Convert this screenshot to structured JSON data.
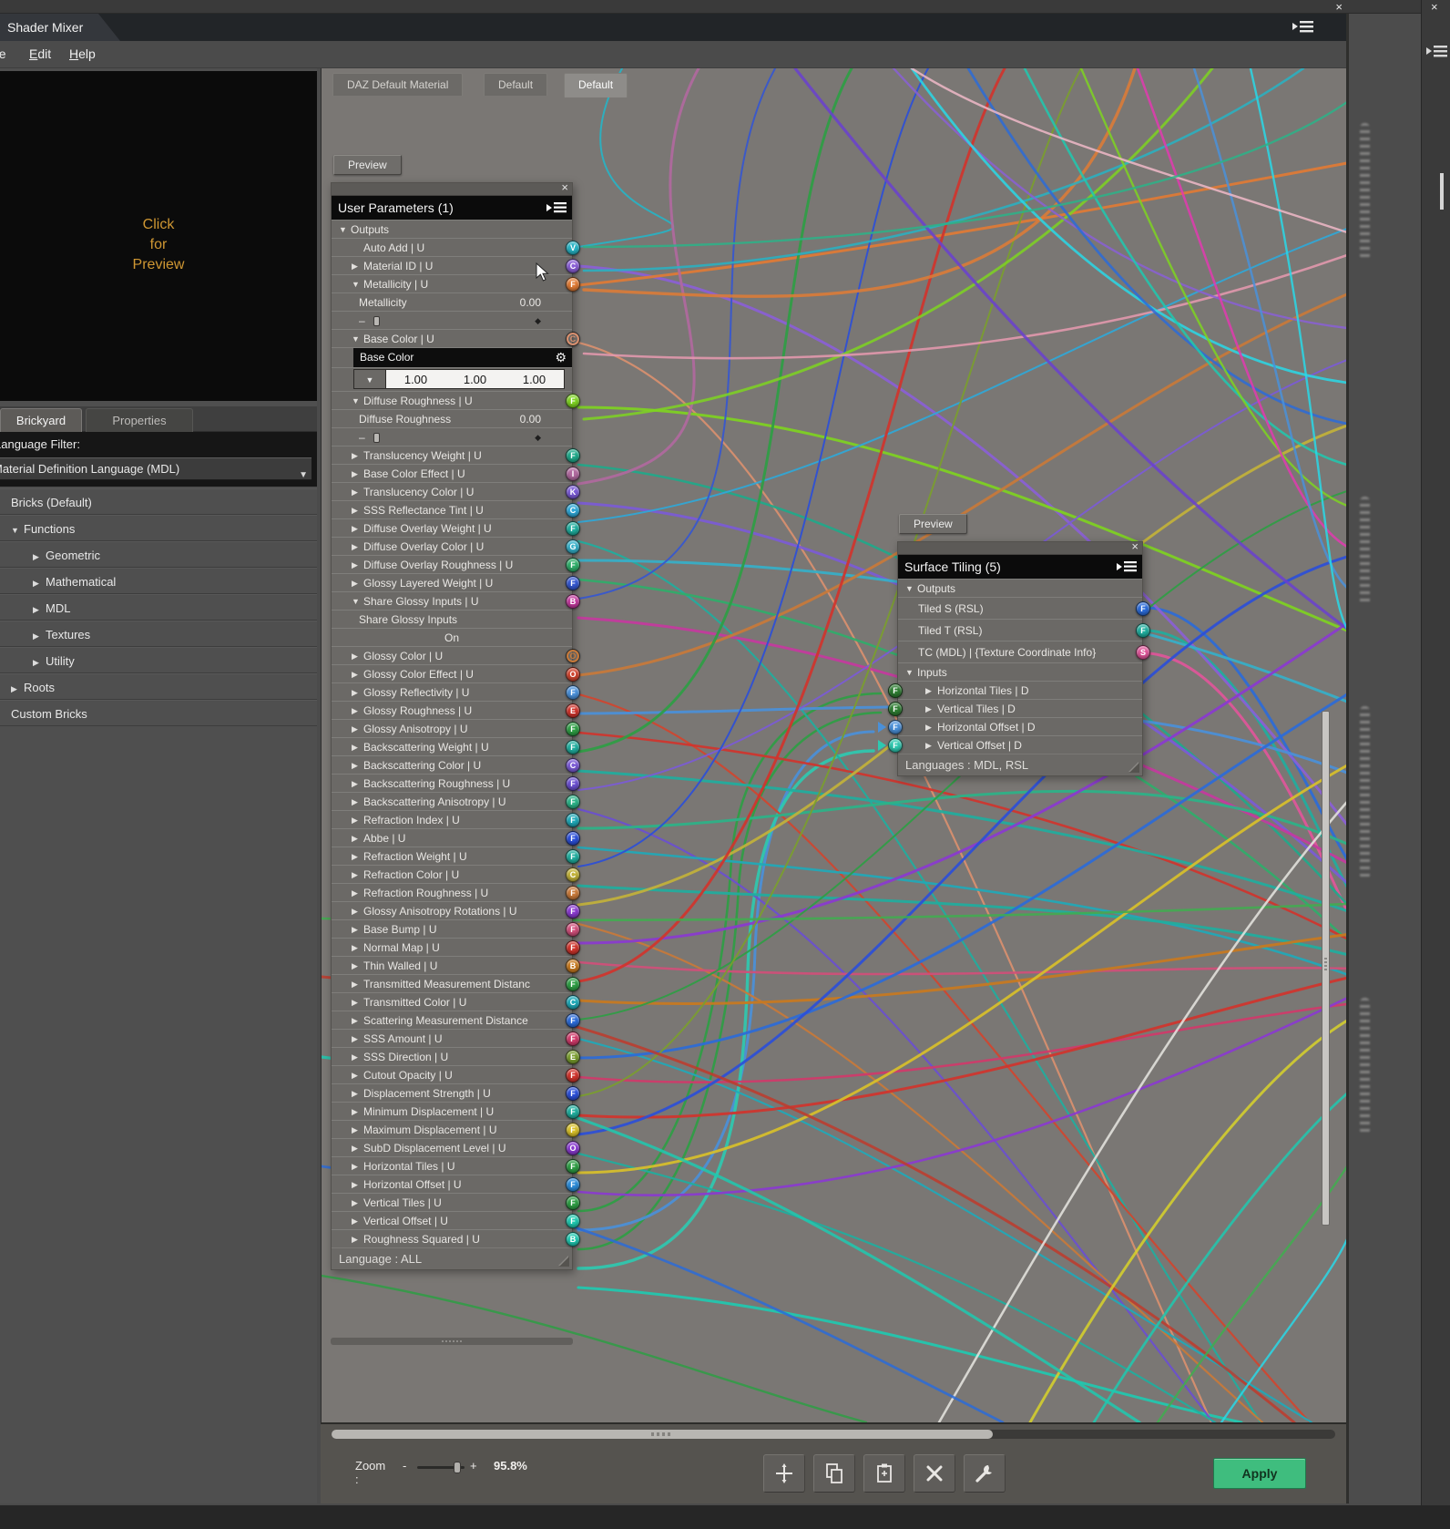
{
  "window": {
    "tab_title": "Shader Mixer",
    "menus": [
      "File",
      "Edit",
      "Help"
    ],
    "close_label": "×"
  },
  "left_panel": {
    "preview_lines": [
      "Click",
      "for",
      "Preview"
    ],
    "preview_text_color": "#cf9733",
    "tabs": [
      {
        "label": "Brickyard",
        "active": true
      },
      {
        "label": "Properties",
        "active": false
      }
    ],
    "language_filter_label": "Language Filter:",
    "language_dropdown_value": "Material Definition Language (MDL)",
    "tree": [
      {
        "label": "Bricks (Default)",
        "indent": 0,
        "arrow": null
      },
      {
        "label": "Functions",
        "indent": 0,
        "arrow": "down"
      },
      {
        "label": "Geometric",
        "indent": 1,
        "arrow": "right"
      },
      {
        "label": "Mathematical",
        "indent": 1,
        "arrow": "right"
      },
      {
        "label": "MDL",
        "indent": 1,
        "arrow": "right"
      },
      {
        "label": "Textures",
        "indent": 1,
        "arrow": "right"
      },
      {
        "label": "Utility",
        "indent": 1,
        "arrow": "right"
      },
      {
        "label": "Roots",
        "indent": 0,
        "arrow": "right"
      },
      {
        "label": "Custom Bricks",
        "indent": 0,
        "arrow": null
      }
    ]
  },
  "canvas": {
    "tabs": [
      {
        "label": "DAZ Default Material",
        "active": false
      },
      {
        "label": "Default",
        "active": false
      },
      {
        "label": "Default",
        "active": true
      }
    ]
  },
  "user_parameters_node": {
    "preview_button": "Preview",
    "title": "User Parameters (1)",
    "footer": "Language : ALL",
    "rows": [
      {
        "kind": "section",
        "label": "Outputs"
      },
      {
        "kind": "param",
        "label": "Auto Add  | U",
        "arrow": null,
        "port": {
          "letter": "V",
          "color": "#27b3c4"
        }
      },
      {
        "kind": "param",
        "label": "Material ID  | U",
        "arrow": "right",
        "port": {
          "letter": "C",
          "color": "#8a5fd6"
        }
      },
      {
        "kind": "param",
        "label": "Metallicity  | U",
        "arrow": "down",
        "port": {
          "letter": "F",
          "color": "#e07b35"
        }
      },
      {
        "kind": "value",
        "label": "Metallicity",
        "value": "0.00"
      },
      {
        "kind": "slider"
      },
      {
        "kind": "param",
        "label": "Base Color  | U",
        "arrow": "down",
        "port": {
          "letter": "C",
          "color": "#d9906f",
          "hollow": true
        }
      },
      {
        "kind": "colorheader",
        "label": "Base Color",
        "gear": "⚙"
      },
      {
        "kind": "colorvalues",
        "values": [
          "1.00",
          "1.00",
          "1.00"
        ]
      },
      {
        "kind": "param",
        "label": "Diffuse Roughness  | U",
        "arrow": "down",
        "port": {
          "letter": "F",
          "color": "#7ed321"
        }
      },
      {
        "kind": "value",
        "label": "Diffuse Roughness",
        "value": "0.00"
      },
      {
        "kind": "slider"
      },
      {
        "kind": "param",
        "label": "Translucency Weight  | U",
        "arrow": "right",
        "port": {
          "letter": "F",
          "color": "#1fa98a"
        }
      },
      {
        "kind": "param",
        "label": "Base Color Effect  | U",
        "arrow": "right",
        "port": {
          "letter": "I",
          "color": "#b0699e"
        }
      },
      {
        "kind": "param",
        "label": "Translucency Color  | U",
        "arrow": "right",
        "port": {
          "letter": "K",
          "color": "#7b5bd6"
        }
      },
      {
        "kind": "param",
        "label": "SSS Reflectance Tint  | U",
        "arrow": "right",
        "port": {
          "letter": "C",
          "color": "#2fa8d8"
        }
      },
      {
        "kind": "param",
        "label": "Diffuse Overlay Weight  | U",
        "arrow": "right",
        "port": {
          "letter": "F",
          "color": "#1fae9e"
        }
      },
      {
        "kind": "param",
        "label": "Diffuse Overlay Color  | U",
        "arrow": "right",
        "port": {
          "letter": "G",
          "color": "#35b0c9"
        }
      },
      {
        "kind": "param",
        "label": "Diffuse Overlay Roughness  | U",
        "arrow": "right",
        "port": {
          "letter": "F",
          "color": "#2fae6a"
        }
      },
      {
        "kind": "param",
        "label": "Glossy Layered Weight  | U",
        "arrow": "right",
        "port": {
          "letter": "F",
          "color": "#3557d0"
        }
      },
      {
        "kind": "param",
        "label": "Share Glossy Inputs  | U",
        "arrow": "down",
        "port": {
          "letter": "B",
          "color": "#c43a9e"
        }
      },
      {
        "kind": "valuelabel",
        "label": "Share Glossy Inputs"
      },
      {
        "kind": "center",
        "label": "On"
      },
      {
        "kind": "param",
        "label": "Glossy Color  | U",
        "arrow": "right",
        "port": {
          "letter": "O",
          "color": "#c87a3a",
          "hollow": true
        }
      },
      {
        "kind": "param",
        "label": "Glossy Color Effect  | U",
        "arrow": "right",
        "port": {
          "letter": "O",
          "color": "#d0452f"
        }
      },
      {
        "kind": "param",
        "label": "Glossy Reflectivity  | U",
        "arrow": "right",
        "port": {
          "letter": "F",
          "color": "#4a90d9"
        }
      },
      {
        "kind": "param",
        "label": "Glossy Roughness  | U",
        "arrow": "right",
        "port": {
          "letter": "E",
          "color": "#d0342c"
        }
      },
      {
        "kind": "param",
        "label": "Glossy Anisotropy  | U",
        "arrow": "right",
        "port": {
          "letter": "F",
          "color": "#2e9e44"
        }
      },
      {
        "kind": "param",
        "label": "Backscattering Weight  | U",
        "arrow": "right",
        "port": {
          "letter": "F",
          "color": "#1fae9e"
        }
      },
      {
        "kind": "param",
        "label": "Backscattering Color  | U",
        "arrow": "right",
        "port": {
          "letter": "C",
          "color": "#7b5bd6"
        }
      },
      {
        "kind": "param",
        "label": "Backscattering Roughness  | U",
        "arrow": "right",
        "port": {
          "letter": "F",
          "color": "#6a4fd0"
        }
      },
      {
        "kind": "param",
        "label": "Backscattering Anisotropy  | U",
        "arrow": "right",
        "port": {
          "letter": "F",
          "color": "#2bb388"
        }
      },
      {
        "kind": "param",
        "label": "Refraction Index  | U",
        "arrow": "right",
        "port": {
          "letter": "F",
          "color": "#1fa9b8"
        }
      },
      {
        "kind": "param",
        "label": "Abbe  | U",
        "arrow": "right",
        "port": {
          "letter": "F",
          "color": "#2b4fd8"
        }
      },
      {
        "kind": "param",
        "label": "Refraction Weight  | U",
        "arrow": "right",
        "port": {
          "letter": "F",
          "color": "#1fae9e"
        }
      },
      {
        "kind": "param",
        "label": "Refraction Color  | U",
        "arrow": "right",
        "port": {
          "letter": "C",
          "color": "#c2b23a"
        }
      },
      {
        "kind": "param",
        "label": "Refraction Roughness  | U",
        "arrow": "right",
        "port": {
          "letter": "F",
          "color": "#c87a3a"
        }
      },
      {
        "kind": "param",
        "label": "Glossy Anisotropy Rotations  | U",
        "arrow": "right",
        "port": {
          "letter": "F",
          "color": "#8a3ad0"
        }
      },
      {
        "kind": "param",
        "label": "Base Bump  | U",
        "arrow": "right",
        "port": {
          "letter": "F",
          "color": "#d04f7a"
        }
      },
      {
        "kind": "param",
        "label": "Normal Map  | U",
        "arrow": "right",
        "port": {
          "letter": "F",
          "color": "#d0342c"
        }
      },
      {
        "kind": "param",
        "label": "Thin Walled  | U",
        "arrow": "right",
        "port": {
          "letter": "B",
          "color": "#c87a1f"
        }
      },
      {
        "kind": "param",
        "label": "Transmitted Measurement Distanc",
        "arrow": "right",
        "port": {
          "letter": "F",
          "color": "#2e9e44"
        }
      },
      {
        "kind": "param",
        "label": "Transmitted Color  | U",
        "arrow": "right",
        "port": {
          "letter": "C",
          "color": "#1fa9b8"
        }
      },
      {
        "kind": "param",
        "label": "Scattering Measurement Distance",
        "arrow": "right",
        "port": {
          "letter": "F",
          "color": "#2b6bd8"
        }
      },
      {
        "kind": "param",
        "label": "SSS Amount  | U",
        "arrow": "right",
        "port": {
          "letter": "F",
          "color": "#d03a6a"
        }
      },
      {
        "kind": "param",
        "label": "SSS Direction  | U",
        "arrow": "right",
        "port": {
          "letter": "E",
          "color": "#7a9e2e"
        }
      },
      {
        "kind": "param",
        "label": "Cutout Opacity  | U",
        "arrow": "right",
        "port": {
          "letter": "F",
          "color": "#d0342c"
        }
      },
      {
        "kind": "param",
        "label": "Displacement Strength  | U",
        "arrow": "right",
        "port": {
          "letter": "F",
          "color": "#2b4fd8"
        }
      },
      {
        "kind": "param",
        "label": "Minimum Displacement  | U",
        "arrow": "right",
        "port": {
          "letter": "F",
          "color": "#1fae9e"
        }
      },
      {
        "kind": "param",
        "label": "Maximum Displacement  | U",
        "arrow": "right",
        "port": {
          "letter": "F",
          "color": "#d8c02a"
        }
      },
      {
        "kind": "param",
        "label": "SubD Displacement Level  | U",
        "arrow": "right",
        "port": {
          "letter": "O",
          "color": "#8a3ad0"
        }
      },
      {
        "kind": "param",
        "label": "Horizontal Tiles  | U",
        "arrow": "right",
        "port": {
          "letter": "F",
          "color": "#2e9e44"
        }
      },
      {
        "kind": "param",
        "label": "Horizontal Offset  | U",
        "arrow": "right",
        "port": {
          "letter": "F",
          "color": "#2b8bd8"
        }
      },
      {
        "kind": "param",
        "label": "Vertical Tiles  | U",
        "arrow": "right",
        "port": {
          "letter": "F",
          "color": "#2e9e44"
        }
      },
      {
        "kind": "param",
        "label": "Vertical Offset  | U",
        "arrow": "right",
        "port": {
          "letter": "F",
          "color": "#1fc9b0"
        }
      },
      {
        "kind": "param",
        "label": "Roughness Squared  | U",
        "arrow": "right",
        "port": {
          "letter": "B",
          "color": "#1fc9b0"
        }
      }
    ]
  },
  "surface_tiling_node": {
    "preview_button": "Preview",
    "title": "Surface Tiling (5)",
    "outputs_label": "Outputs",
    "inputs_label": "Inputs",
    "outputs": [
      {
        "label": "Tiled S (RSL)",
        "port": {
          "letter": "F",
          "color": "#2b6bd8"
        }
      },
      {
        "label": "Tiled T (RSL)",
        "port": {
          "letter": "F",
          "color": "#1fae9e"
        }
      },
      {
        "label": "TC (MDL)  | {Texture Coordinate Info}",
        "port": {
          "letter": "S",
          "color": "#e0569a"
        }
      }
    ],
    "inputs": [
      {
        "label": "Horizontal Tiles  | D",
        "port": {
          "letter": "F",
          "color": "#2e7d32"
        },
        "arrow_in": false
      },
      {
        "label": "Vertical Tiles  | D",
        "port": {
          "letter": "F",
          "color": "#2e7d32"
        },
        "arrow_in": false
      },
      {
        "label": "Horizontal Offset  | D",
        "port": {
          "letter": "F",
          "color": "#4a90d9"
        },
        "arrow_in": true
      },
      {
        "label": "Vertical Offset  | D",
        "port": {
          "letter": "F",
          "color": "#2ec9b0"
        },
        "arrow_in": true
      }
    ],
    "footer": "Languages : MDL, RSL"
  },
  "bottom_bar": {
    "zoom_label": "Zoom :",
    "zoom_minus": "-",
    "zoom_plus": "+",
    "zoom_value": "95.8%",
    "buttons": [
      {
        "name": "add-node-button",
        "icon": "move-plus-icon"
      },
      {
        "name": "copy-button",
        "icon": "copy-icon"
      },
      {
        "name": "paste-button",
        "icon": "paste-icon"
      },
      {
        "name": "delete-button",
        "icon": "delete-x-icon"
      },
      {
        "name": "tools-button",
        "icon": "wrench-icon"
      }
    ],
    "apply_label": "Apply",
    "apply_color": "#3fbd7e"
  }
}
